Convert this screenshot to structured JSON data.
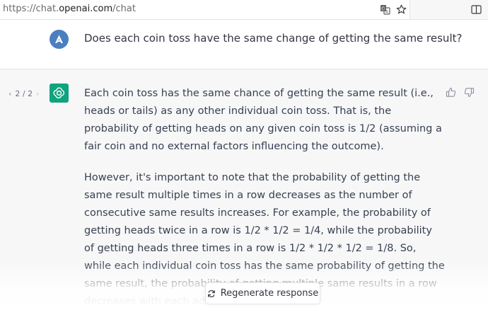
{
  "browser": {
    "url_scheme": "https://chat.",
    "url_host": "openai.com",
    "url_path": "/chat",
    "icons": [
      "translate-icon",
      "bookmark-star-icon",
      "sidebar-toggle-icon"
    ]
  },
  "conversation": {
    "question": "Does each coin toss have the same change of getting the same result?",
    "pager": {
      "prev": "‹",
      "label": "2 / 2",
      "next": "›"
    },
    "answer_paragraphs": [
      "Each coin toss has the same chance of getting the same result (i.e., heads or tails) as any other individual coin toss. That is, the probability of getting heads on any given coin toss is 1/2 (assuming a fair coin and no external factors influencing the outcome).",
      "However, it's important to note that the probability of getting the same result multiple times in a row decreases as the number of consecutive same results increases. For example, the probability of getting heads twice in a row is 1/2 * 1/2 = 1/4, while the probability of getting heads three times in a row is 1/2 * 1/2 * 1/2 = 1/8. So, while each individual coin toss has the same probability of getting the same result, the probability of getting multiple same results in a row decreases with each additional toss."
    ]
  },
  "actions": {
    "regenerate_label": "Regenerate response"
  },
  "colors": {
    "user_avatar": "#4a7fc1",
    "assistant_avatar": "#10a37f",
    "answer_bg": "#f7f7f8"
  }
}
